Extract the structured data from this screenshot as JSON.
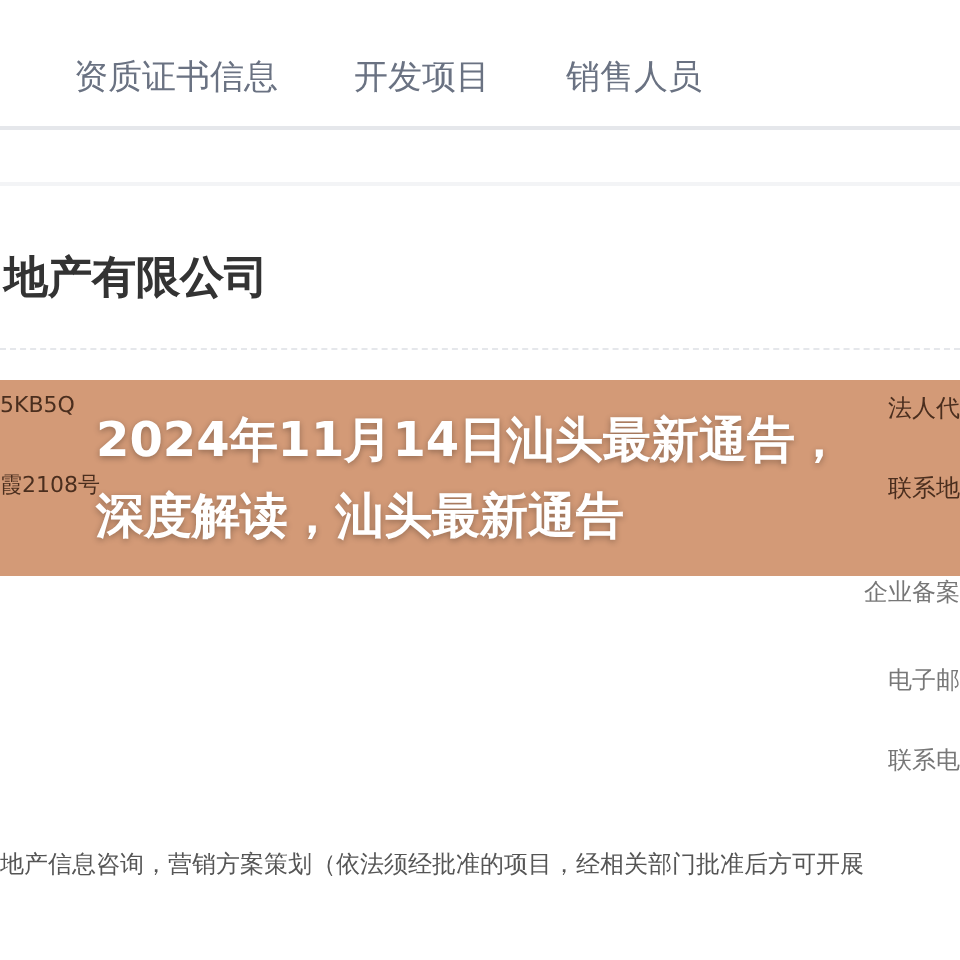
{
  "tabs": [
    {
      "label": "资质证书信息"
    },
    {
      "label": "开发项目"
    },
    {
      "label": "销售人员"
    }
  ],
  "company_name": "地产有限公司",
  "info_rows": [
    {
      "left": "5KB5Q",
      "right": "法人代"
    },
    {
      "left": "霞2108号",
      "right": "联系地"
    },
    {
      "left": "",
      "right": "企业备案"
    },
    {
      "left": "",
      "right": "电子邮"
    },
    {
      "left": "",
      "right": "联系电"
    }
  ],
  "business_scope": "地产信息咨询，营销方案策划（依法须经批准的项目，经相关部门批准后方可开展",
  "overlay_title": "2024年11月14日汕头最新通告，深度解读，汕头最新通告"
}
